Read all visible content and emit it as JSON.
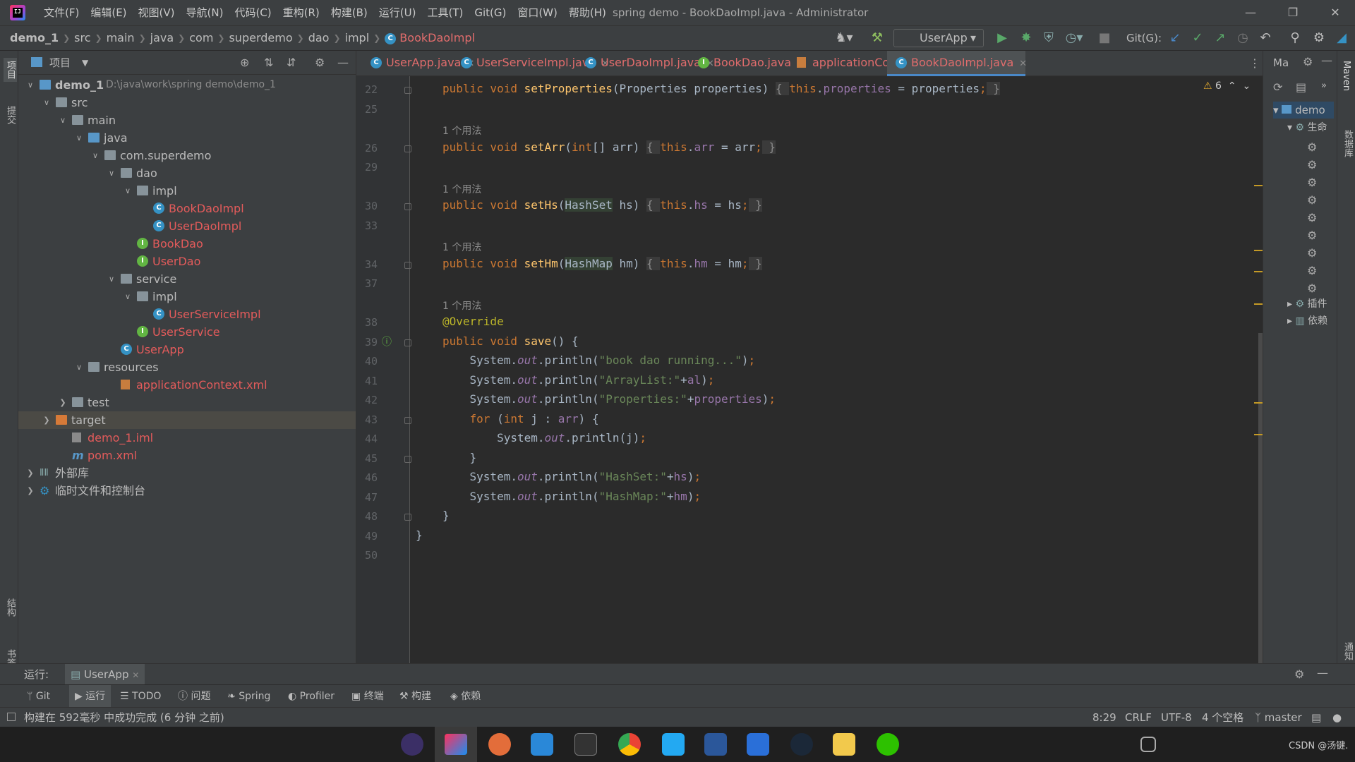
{
  "window": {
    "title": "spring demo - BookDaoImpl.java - Administrator",
    "logo": "IJ"
  },
  "menu": [
    "文件(F)",
    "编辑(E)",
    "视图(V)",
    "导航(N)",
    "代码(C)",
    "重构(R)",
    "构建(B)",
    "运行(U)",
    "工具(T)",
    "Git(G)",
    "窗口(W)",
    "帮助(H)"
  ],
  "breadcrumb": [
    "demo_1",
    "src",
    "main",
    "java",
    "com",
    "superdemo",
    "dao",
    "impl",
    "BookDaoImpl"
  ],
  "toolbar": {
    "run_config": "UserApp",
    "git_label": "Git(G):"
  },
  "left_strip": {
    "project": "项目",
    "commit": "提交",
    "structure": "结构",
    "bookmarks": "书签"
  },
  "right_strip": {
    "maven": "Maven",
    "database": "数据库",
    "notifications": "通知"
  },
  "project_panel": {
    "title": "项目",
    "tree": [
      {
        "label": "demo_1",
        "extra": "D:\\java\\work\\spring demo\\demo_1",
        "depth": 0,
        "expanded": true,
        "icon": "module-folder-icon",
        "bold": true
      },
      {
        "label": "src",
        "depth": 1,
        "expanded": true,
        "icon": "folder-icon"
      },
      {
        "label": "main",
        "depth": 2,
        "expanded": true,
        "icon": "folder-icon"
      },
      {
        "label": "java",
        "depth": 3,
        "expanded": true,
        "icon": "source-folder-icon"
      },
      {
        "label": "com.superdemo",
        "depth": 4,
        "expanded": true,
        "icon": "package-icon"
      },
      {
        "label": "dao",
        "depth": 5,
        "expanded": true,
        "icon": "package-icon"
      },
      {
        "label": "impl",
        "depth": 6,
        "expanded": true,
        "icon": "package-icon"
      },
      {
        "label": "BookDaoImpl",
        "depth": 7,
        "icon": "class-icon",
        "red": true
      },
      {
        "label": "UserDaoImpl",
        "depth": 7,
        "icon": "class-icon",
        "red": true
      },
      {
        "label": "BookDao",
        "depth": 6,
        "icon": "interface-icon",
        "red": true
      },
      {
        "label": "UserDao",
        "depth": 6,
        "icon": "interface-icon",
        "red": true
      },
      {
        "label": "service",
        "depth": 5,
        "expanded": true,
        "icon": "package-icon"
      },
      {
        "label": "impl",
        "depth": 6,
        "expanded": true,
        "icon": "package-icon"
      },
      {
        "label": "UserServiceImpl",
        "depth": 7,
        "icon": "class-icon",
        "red": true
      },
      {
        "label": "UserService",
        "depth": 6,
        "icon": "interface-icon",
        "red": true
      },
      {
        "label": "UserApp",
        "depth": 5,
        "icon": "app-class-icon",
        "red": true
      },
      {
        "label": "resources",
        "depth": 3,
        "expanded": true,
        "icon": "resources-folder-icon"
      },
      {
        "label": "applicationContext.xml",
        "depth": 5,
        "icon": "xml-icon",
        "red": true
      },
      {
        "label": "test",
        "depth": 2,
        "expanded": false,
        "icon": "folder-icon"
      },
      {
        "label": "target",
        "depth": 1,
        "expanded": false,
        "icon": "excluded-folder-icon",
        "selected": true
      },
      {
        "label": "demo_1.iml",
        "depth": 2,
        "icon": "iml-icon",
        "red": true
      },
      {
        "label": "pom.xml",
        "depth": 2,
        "icon": "maven-icon",
        "red": true
      },
      {
        "label": "外部库",
        "depth": 0,
        "expanded": false,
        "icon": "library-icon"
      },
      {
        "label": "临时文件和控制台",
        "depth": 0,
        "expanded": false,
        "icon": "scratch-icon"
      }
    ]
  },
  "tabs": [
    {
      "label": "UserApp.java",
      "icon": "C"
    },
    {
      "label": "UserServiceImpl.java",
      "icon": "C"
    },
    {
      "label": "UserDaoImpl.java",
      "icon": "C"
    },
    {
      "label": "BookDao.java",
      "icon": "I"
    },
    {
      "label": "applicationContext.xml",
      "icon": "X"
    },
    {
      "label": "BookDaoImpl.java",
      "icon": "C",
      "active": true
    }
  ],
  "editor": {
    "warning_count": "6",
    "usage_hint": "1 个用法",
    "lines": [
      {
        "n": "22",
        "html": "<span class='kw'>public void </span><span class='fn'>setProperties</span>(Properties properties) <span class='fold'>{ </span><span class='kw'>this</span>.<span class='fld'>properties</span> = properties<span class='kw'>;</span><span class='fold'> }</span>"
      },
      {
        "n": "25",
        "html": ""
      },
      {
        "n": "26",
        "html": "<span class='kw'>public void </span><span class='fn'>setArr</span>(<span class='kw'>int</span>[] arr) <span class='fold'>{ </span><span class='kw'>this</span>.<span class='fld'>arr</span> = arr<span class='kw'>;</span><span class='fold'> }</span>",
        "hint": true
      },
      {
        "n": "29",
        "html": ""
      },
      {
        "n": "30",
        "html": "<span class='kw'>public void </span><span class='fn'>setHs</span>(<span class='hl'>HashSet</span> hs) <span class='fold'>{ </span><span class='kw'>this</span>.<span class='fld'>hs</span> = hs<span class='kw'>;</span><span class='fold'> }</span>",
        "hint": true
      },
      {
        "n": "33",
        "html": ""
      },
      {
        "n": "34",
        "html": "<span class='kw'>public void </span><span class='fn'>setHm</span>(<span class='hl'>HashMap</span> hm) <span class='fold'>{ </span><span class='kw'>this</span>.<span class='fld'>hm</span> = hm<span class='kw'>;</span><span class='fold'> }</span>",
        "hint": true
      },
      {
        "n": "37",
        "html": ""
      },
      {
        "n": "38",
        "html": "<span class='ann'>@Override</span>",
        "hint": true
      },
      {
        "n": "39",
        "html": "<span class='kw'>public void </span><span class='fn'>save</span>() {"
      },
      {
        "n": "40",
        "html": "    System.<span class='st'>out</span>.println(<span class='str'>\"book dao running...\"</span>)<span class='kw'>;</span>"
      },
      {
        "n": "41",
        "html": "    System.<span class='st'>out</span>.println(<span class='str'>\"ArrayList:\"</span>+<span class='fld'>al</span>)<span class='kw'>;</span>"
      },
      {
        "n": "42",
        "html": "    System.<span class='st'>out</span>.println(<span class='str'>\"Properties:\"</span>+<span class='fld'>properties</span>)<span class='kw'>;</span>"
      },
      {
        "n": "43",
        "html": "    <span class='kw'>for </span>(<span class='kw'>int </span>j : <span class='fld'>arr</span>) {"
      },
      {
        "n": "44",
        "html": "        System.<span class='st'>out</span>.println(j)<span class='kw'>;</span>"
      },
      {
        "n": "45",
        "html": "    }"
      },
      {
        "n": "46",
        "html": "    System.<span class='st'>out</span>.println(<span class='str'>\"HashSet:\"</span>+<span class='fld'>hs</span>)<span class='kw'>;</span>"
      },
      {
        "n": "47",
        "html": "    System.<span class='st'>out</span>.println(<span class='str'>\"HashMap:\"</span>+<span class='fld'>hm</span>)<span class='kw'>;</span>"
      },
      {
        "n": "48",
        "html": "}"
      },
      {
        "n": "49",
        "html": "}",
        "outer": true
      },
      {
        "n": "50",
        "html": ""
      }
    ]
  },
  "maven_panel": {
    "title": "Ma",
    "root": "demo",
    "item_lifecycle": "生命",
    "item_plugins": "插件",
    "item_deps": "依赖"
  },
  "run_bar": {
    "label": "运行:",
    "tab": "UserApp"
  },
  "tool_windows": [
    "Git",
    "运行",
    "TODO",
    "问题",
    "Spring",
    "Profiler",
    "终端",
    "构建",
    "依赖"
  ],
  "status": {
    "message": "构建在 592毫秒 中成功完成 (6 分钟 之前)",
    "position": "8:29",
    "line_sep": "CRLF",
    "encoding": "UTF-8",
    "indent": "4 个空格",
    "branch": "master"
  },
  "taskbar": {
    "watermark": "CSDN @汤键."
  },
  "colors": {
    "accent": "#4a88c7",
    "warning": "#c49a26",
    "class_icon": "#3592c4",
    "interface_icon": "#62b543"
  }
}
